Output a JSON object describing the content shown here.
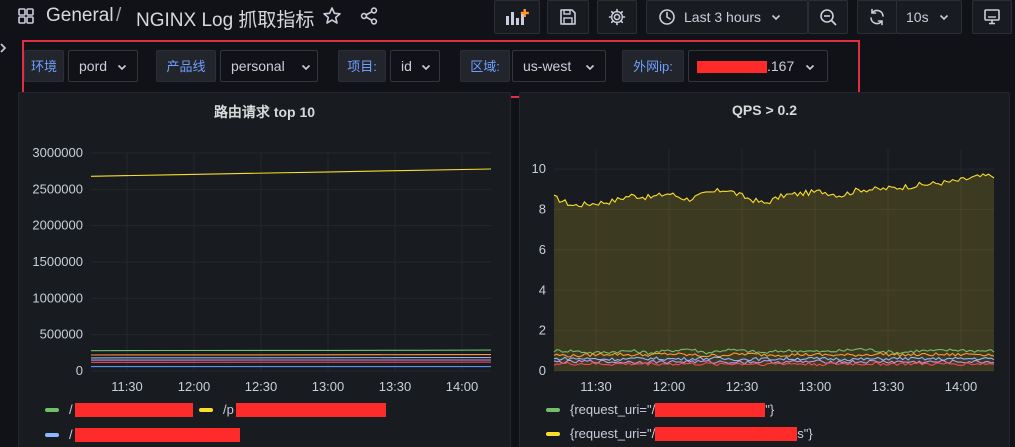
{
  "header": {
    "breadcrumb_folder": "General",
    "breadcrumb_separator": "/",
    "dashboard_title": "NGINX Log 抓取指标",
    "time_range_label": "Last 3 hours",
    "refresh_interval_label": "10s"
  },
  "variables": {
    "env": {
      "label": "环境",
      "value": "pord"
    },
    "product": {
      "label": "产品线",
      "value": "personal"
    },
    "project": {
      "label": "项目:",
      "value": "id"
    },
    "region": {
      "label": "区域:",
      "value": "us-west"
    },
    "ip": {
      "label": "外网ip:",
      "value_suffix": ".167"
    }
  },
  "colors": {
    "yellow": "#fade2a",
    "green": "#73bf69",
    "blue": "#8ab8ff",
    "orange": "#ff9830",
    "red_redaction": "#ff2b2b",
    "variable_label": "#6e9fff",
    "highlight_box": "#e02f44"
  },
  "panels": {
    "left": {
      "title": "路由请求 top 10",
      "legend": [
        {
          "text": "/",
          "color": "#73bf69"
        },
        {
          "text": "/p",
          "color": "#fade2a"
        },
        {
          "text": "/",
          "color": "#8ab8ff"
        }
      ]
    },
    "right": {
      "title": "QPS > 0.2",
      "legend": [
        {
          "text": "{request_uri=\"/",
          "tail": "\"}",
          "color": "#73bf69"
        },
        {
          "text": "{request_uri=\"/",
          "tail": "s\"}",
          "color": "#fade2a"
        }
      ]
    }
  },
  "chart_data": [
    {
      "type": "line",
      "title": "路由请求 top 10",
      "x": [
        "11:30",
        "12:00",
        "12:30",
        "13:00",
        "13:30",
        "14:00"
      ],
      "ylim": [
        0,
        3000000
      ],
      "yticks": [
        "0",
        "500000",
        "1000000",
        "1500000",
        "2000000",
        "2500000",
        "3000000"
      ],
      "series": [
        {
          "color": "#fade2a",
          "values": [
            2680000,
            2700000,
            2720000,
            2740000,
            2760000,
            2780000
          ]
        },
        {
          "color": "#73bf69",
          "values": [
            280000,
            282000,
            283000,
            284000,
            285000,
            287000
          ]
        },
        {
          "color": "#ff9830",
          "values": [
            220000,
            221000,
            222000,
            223000,
            224000,
            225000
          ]
        },
        {
          "color": "#8ab8ff",
          "values": [
            180000,
            181000,
            182000,
            183000,
            184000,
            185000
          ]
        },
        {
          "color": "#ca95e5",
          "values": [
            150000,
            150000,
            151000,
            151000,
            152000,
            152000
          ]
        },
        {
          "color": "#f2495c",
          "values": [
            120000,
            120000,
            121000,
            121000,
            121000,
            122000
          ]
        },
        {
          "color": "#5794f2",
          "values": [
            60000,
            60000,
            60000,
            61000,
            61000,
            61000
          ]
        }
      ]
    },
    {
      "type": "area",
      "title": "QPS > 0.2",
      "x": [
        "11:30",
        "12:00",
        "12:30",
        "13:00",
        "13:30",
        "14:00"
      ],
      "ylim": [
        0,
        11
      ],
      "yticks": [
        "0",
        "2",
        "4",
        "6",
        "8",
        "10"
      ],
      "series": [
        {
          "color": "#fade2a",
          "fill": true,
          "values": [
            8.6,
            8.2,
            8.3,
            8.4,
            8.7,
            8.6,
            8.8,
            8.5,
            8.8,
            9.0,
            8.6,
            8.3,
            8.7,
            8.8,
            8.9,
            8.7,
            9.0,
            9.0,
            9.1,
            9.2,
            9.3,
            9.4,
            9.6,
            9.7
          ]
        },
        {
          "color": "#73bf69",
          "values": [
            1.0,
            1.0,
            0.9,
            0.95,
            1.0,
            0.9,
            1.0,
            1.1,
            0.9,
            1.05,
            1.0,
            0.9,
            1.0,
            1.0,
            0.95,
            1.0,
            1.1,
            1.0,
            0.9,
            1.0,
            1.0,
            1.05,
            1.0,
            1.0
          ]
        },
        {
          "color": "#ff9830",
          "values": [
            0.8,
            0.75,
            0.8,
            0.85,
            0.8,
            0.8,
            0.85,
            0.8,
            0.75,
            0.8,
            0.85,
            0.8,
            0.8,
            0.82,
            0.8,
            0.78,
            0.8,
            0.85,
            0.8,
            0.8,
            0.82,
            0.8,
            0.85,
            0.8
          ]
        },
        {
          "color": "#8ab8ff",
          "values": [
            0.6,
            0.62,
            0.6,
            0.58,
            0.6,
            0.62,
            0.6,
            0.6,
            0.63,
            0.6,
            0.58,
            0.6,
            0.6,
            0.62,
            0.6,
            0.6,
            0.58,
            0.6,
            0.62,
            0.6,
            0.6,
            0.6,
            0.62,
            0.6
          ]
        },
        {
          "color": "#ca95e5",
          "values": [
            0.45,
            0.45,
            0.48,
            0.45,
            0.44,
            0.46,
            0.45,
            0.47,
            0.45,
            0.45,
            0.44,
            0.46,
            0.45,
            0.45,
            0.47,
            0.45,
            0.45,
            0.46,
            0.45,
            0.44,
            0.45,
            0.46,
            0.45,
            0.45
          ]
        },
        {
          "color": "#f2495c",
          "values": [
            0.35,
            0.36,
            0.35,
            0.34,
            0.35,
            0.36,
            0.35,
            0.35,
            0.34,
            0.36,
            0.35,
            0.35,
            0.36,
            0.35,
            0.34,
            0.35,
            0.35,
            0.36,
            0.35,
            0.35,
            0.34,
            0.35,
            0.36,
            0.35
          ]
        }
      ]
    }
  ]
}
